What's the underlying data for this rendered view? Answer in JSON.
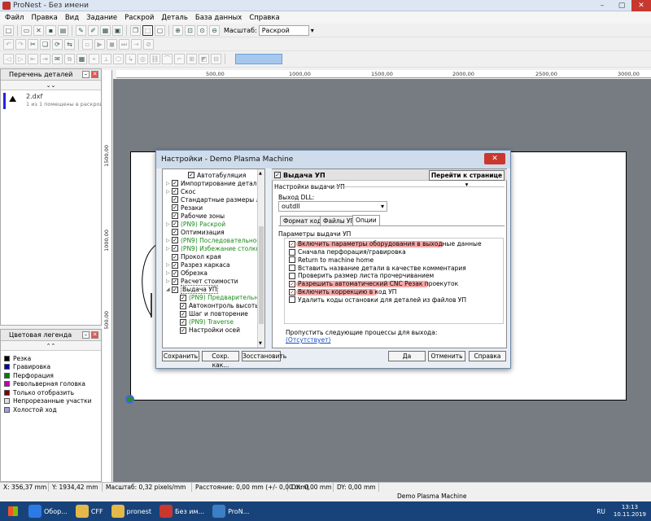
{
  "app": {
    "title": "ProNest - Без имени"
  },
  "menu": [
    "Файл",
    "Правка",
    "Вид",
    "Задание",
    "Раскрой",
    "Деталь",
    "База данных",
    "Справка"
  ],
  "toolbar": {
    "zoom_label": "Масштаб:",
    "zoom_value": "Раскрой"
  },
  "left_panel": {
    "parts_title": "Перечень деталей",
    "part_name": "2.dxf",
    "part_desc": "1 из 1 помещены в раскрой"
  },
  "legend": {
    "title": "Цветовая легенда",
    "items": [
      {
        "label": "Резка",
        "color": "#000000"
      },
      {
        "label": "Гравировка",
        "color": "#0000b0"
      },
      {
        "label": "Перфорация",
        "color": "#008000"
      },
      {
        "label": "Револьверная головка",
        "color": "#c000c0"
      },
      {
        "label": "Только отобразить",
        "color": "#800000"
      },
      {
        "label": "Непрорезанные участки",
        "color": "#e0e0e0"
      },
      {
        "label": "Холостой ход",
        "color": "#a0a0e8"
      }
    ]
  },
  "ruler": {
    "h": [
      "500,00",
      "1000,00",
      "1500,00",
      "2000,00",
      "2500,00",
      "3000,00"
    ],
    "v": [
      "1500,00",
      "1000,00",
      "500,00"
    ]
  },
  "dialog": {
    "title": "Настройки - Demo Plasma Machine",
    "tree": [
      {
        "label": "Автотабуляция",
        "checked": true,
        "green": false,
        "arrow": false,
        "indent": 2
      },
      {
        "label": "Импортирование деталей",
        "checked": true,
        "green": false,
        "arrow": true,
        "indent": 0
      },
      {
        "label": "Скос",
        "checked": true,
        "green": false,
        "arrow": true,
        "indent": 0
      },
      {
        "label": "Стандартные размеры листа",
        "checked": true,
        "green": false,
        "arrow": false,
        "indent": 0
      },
      {
        "label": "Резаки",
        "checked": true,
        "green": false,
        "arrow": false,
        "indent": 0
      },
      {
        "label": "Рабочие зоны",
        "checked": true,
        "green": false,
        "arrow": false,
        "indent": 0
      },
      {
        "label": "(PN9) Раскрой",
        "checked": true,
        "green": true,
        "arrow": true,
        "indent": 0
      },
      {
        "label": "Оптимизация",
        "checked": true,
        "green": false,
        "arrow": false,
        "indent": 0
      },
      {
        "label": "(PN9) Последовательность резки",
        "checked": true,
        "green": true,
        "arrow": true,
        "indent": 0
      },
      {
        "label": "(PN9) Избежание столкновений",
        "checked": true,
        "green": true,
        "arrow": true,
        "indent": 0
      },
      {
        "label": "Прокол края",
        "checked": true,
        "green": false,
        "arrow": false,
        "indent": 0
      },
      {
        "label": "Разрез каркаса",
        "checked": true,
        "green": false,
        "arrow": true,
        "indent": 0
      },
      {
        "label": "Обрезка",
        "checked": true,
        "green": false,
        "arrow": true,
        "indent": 0
      },
      {
        "label": "Расчет стоимости",
        "checked": true,
        "green": false,
        "arrow": true,
        "indent": 0
      },
      {
        "label": "Выдача УП",
        "checked": true,
        "green": false,
        "arrow": true,
        "indent": 0,
        "expanded": true
      },
      {
        "label": "(PN9) Предварительные",
        "checked": true,
        "green": true,
        "arrow": false,
        "indent": 1
      },
      {
        "label": "Автоконтроль высоты",
        "checked": true,
        "green": false,
        "arrow": false,
        "indent": 1
      },
      {
        "label": "Шаг и повторение",
        "checked": true,
        "green": false,
        "arrow": false,
        "indent": 1
      },
      {
        "label": "(PN9) Traverse",
        "checked": true,
        "green": true,
        "arrow": false,
        "indent": 1
      },
      {
        "label": "Настройки осей",
        "checked": true,
        "green": false,
        "arrow": false,
        "indent": 1
      }
    ],
    "section_title": "Выдача УП",
    "goto_label": "Перейти к странице",
    "subsection": "Настройки выдачи УП",
    "dll_label": "Выход DLL:",
    "dll_value": "outdll",
    "tabs": [
      "Формат кода",
      "Файлы УП",
      "Опции"
    ],
    "params_title": "Параметры выдачи УП",
    "options": [
      {
        "label": "Включить параметры оборудования в выходные данные",
        "checked": true,
        "highlight": true
      },
      {
        "label": "Сначала перфорация/гравировка",
        "checked": false,
        "highlight": false
      },
      {
        "label": "Return to machine home",
        "checked": false,
        "highlight": false
      },
      {
        "label": "Вставить название детали в качестве комментария",
        "checked": false,
        "highlight": false
      },
      {
        "label": "Проверить размер листа прочерчиванием",
        "checked": false,
        "highlight": false
      },
      {
        "label": "Разрешить автоматический CNC Резак проекуток",
        "checked": true,
        "highlight": true
      },
      {
        "label": "Включить коррекцию в код УП",
        "checked": true,
        "highlight": true
      },
      {
        "label": "Удалить коды остановки для деталей из файлов УП",
        "checked": false,
        "highlight": false
      }
    ],
    "skip_label": "Пропустить следующие процессы для выхода:",
    "skip_value": "(Отсутствует)",
    "buttons": {
      "save": "Сохранить",
      "save_as": "Сохр. как...",
      "restore": "Зосстановить",
      "ok": "Да",
      "cancel": "Отменить",
      "help": "Справка"
    }
  },
  "status": [
    "X: 356,37 mm",
    "Y: 1934,42 mm",
    "Масштаб: 0,32 pixels/mm",
    "Расстояние: 0,00 mm (+/- 0,00 mm)",
    "DX: 0,00 mm",
    "DY: 0,00 mm"
  ],
  "task_band": "Demo Plasma Machine",
  "taskbar": {
    "items": [
      {
        "label": "Обор...",
        "color": "#2c7be5"
      },
      {
        "label": "CFF",
        "color": "#e6b84a"
      },
      {
        "label": "pronest",
        "color": "#e6b84a"
      },
      {
        "label": "Без им...",
        "color": "#c8382e"
      },
      {
        "label": "ProN...",
        "color": "#3b7fc4"
      }
    ],
    "lang": "RU",
    "time": "13:13",
    "date": "10.11.2019"
  },
  "colors": {
    "highlight": "#f05050",
    "green": "#1b8a1b",
    "taskbar": "#18437a"
  }
}
